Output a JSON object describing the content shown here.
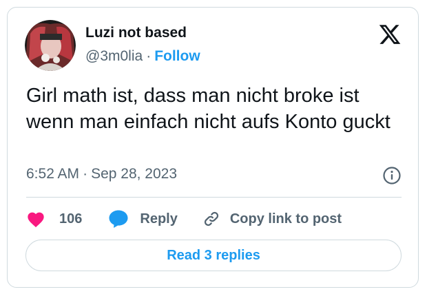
{
  "author": {
    "display_name": "Luzi not based",
    "handle": "@3m0lia",
    "separator": "·",
    "follow_label": "Follow"
  },
  "tweet": {
    "text": "Girl math ist, dass man nicht broke ist wenn man einfach nicht aufs Konto guckt",
    "time": "6:52 AM",
    "date_separator": "·",
    "date": "Sep 28, 2023"
  },
  "actions": {
    "like_count": "106",
    "reply_label": "Reply",
    "copy_link_label": "Copy link to post"
  },
  "read_replies_label": "Read 3 replies",
  "colors": {
    "accent_blue": "#1d9bf0",
    "like_pink": "#f91880",
    "secondary_text": "#536471",
    "border": "#cfd9de"
  },
  "icons": {
    "brand": "x-logo-icon",
    "info": "info-icon",
    "like": "heart-icon",
    "reply": "speech-bubble-icon",
    "copy": "link-icon"
  }
}
